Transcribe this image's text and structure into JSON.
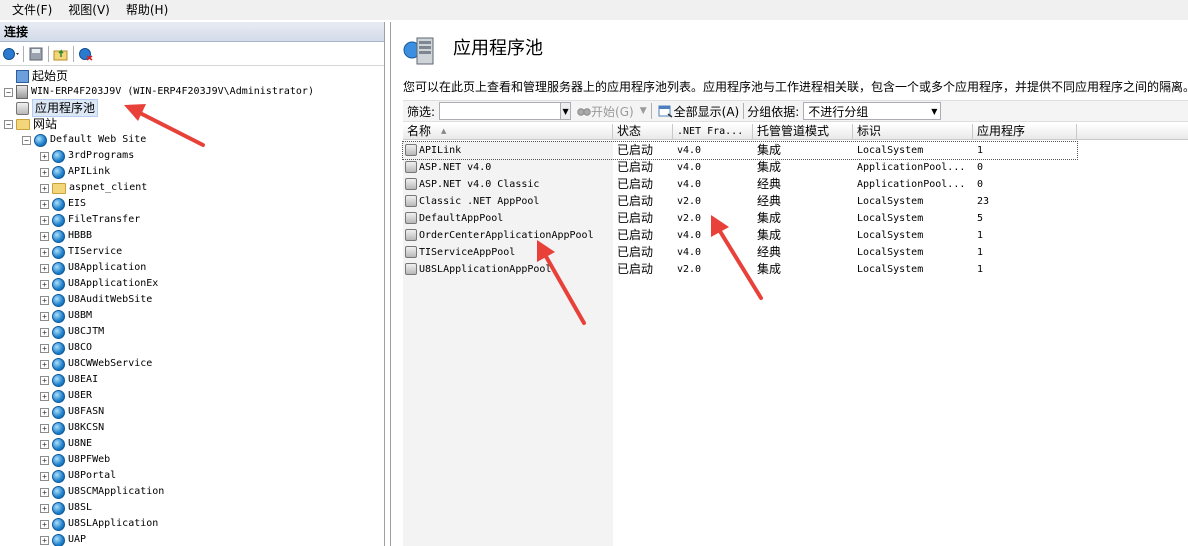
{
  "menu": [
    {
      "label": "文件(F)"
    },
    {
      "label": "视图(V)"
    },
    {
      "label": "帮助(H)"
    }
  ],
  "connections": {
    "title": "连接",
    "tree": [
      {
        "label": "起始页",
        "icon": "home-icon",
        "level": 0,
        "expander": "",
        "cn": true
      },
      {
        "label": "WIN-ERP4F203J9V (WIN-ERP4F203J9V\\Administrator)",
        "icon": "server-icon",
        "level": 0,
        "expander": "−",
        "cn": false
      },
      {
        "label": "应用程序池",
        "icon": "app-pool-icon",
        "level": 1,
        "expander": "",
        "cn": true,
        "selected": true
      },
      {
        "label": "网站",
        "icon": "sites-folder-icon",
        "level": 1,
        "expander": "−",
        "cn": true
      },
      {
        "label": "Default Web Site",
        "icon": "globe-icon",
        "level": 2,
        "expander": "−",
        "cn": false
      },
      {
        "label": "3rdPrograms",
        "icon": "globe-icon",
        "level": 3,
        "expander": "+",
        "cn": false
      },
      {
        "label": "APILink",
        "icon": "globe-icon",
        "level": 3,
        "expander": "+",
        "cn": false
      },
      {
        "label": "aspnet_client",
        "icon": "folder-icon",
        "level": 3,
        "expander": "+",
        "cn": false
      },
      {
        "label": "EIS",
        "icon": "globe-icon",
        "level": 3,
        "expander": "+",
        "cn": false
      },
      {
        "label": "FileTransfer",
        "icon": "globe-icon",
        "level": 3,
        "expander": "+",
        "cn": false
      },
      {
        "label": "HBBB",
        "icon": "globe-icon",
        "level": 3,
        "expander": "+",
        "cn": false
      },
      {
        "label": "TIService",
        "icon": "globe-icon",
        "level": 3,
        "expander": "+",
        "cn": false
      },
      {
        "label": "U8Application",
        "icon": "globe-icon",
        "level": 3,
        "expander": "+",
        "cn": false
      },
      {
        "label": "U8ApplicationEx",
        "icon": "globe-icon",
        "level": 3,
        "expander": "+",
        "cn": false
      },
      {
        "label": "U8AuditWebSite",
        "icon": "globe-icon",
        "level": 3,
        "expander": "+",
        "cn": false
      },
      {
        "label": "U8BM",
        "icon": "globe-icon",
        "level": 3,
        "expander": "+",
        "cn": false
      },
      {
        "label": "U8CJTM",
        "icon": "globe-icon",
        "level": 3,
        "expander": "+",
        "cn": false
      },
      {
        "label": "U8CO",
        "icon": "globe-icon",
        "level": 3,
        "expander": "+",
        "cn": false
      },
      {
        "label": "U8CWWebService",
        "icon": "globe-icon",
        "level": 3,
        "expander": "+",
        "cn": false
      },
      {
        "label": "U8EAI",
        "icon": "globe-icon",
        "level": 3,
        "expander": "+",
        "cn": false
      },
      {
        "label": "U8ER",
        "icon": "globe-icon",
        "level": 3,
        "expander": "+",
        "cn": false
      },
      {
        "label": "U8FASN",
        "icon": "globe-icon",
        "level": 3,
        "expander": "+",
        "cn": false
      },
      {
        "label": "U8KCSN",
        "icon": "globe-icon",
        "level": 3,
        "expander": "+",
        "cn": false
      },
      {
        "label": "U8NE",
        "icon": "globe-icon",
        "level": 3,
        "expander": "+",
        "cn": false
      },
      {
        "label": "U8PFWeb",
        "icon": "globe-icon",
        "level": 3,
        "expander": "+",
        "cn": false
      },
      {
        "label": "U8Portal",
        "icon": "globe-icon",
        "level": 3,
        "expander": "+",
        "cn": false
      },
      {
        "label": "U8SCMApplication",
        "icon": "globe-icon",
        "level": 3,
        "expander": "+",
        "cn": false
      },
      {
        "label": "U8SL",
        "icon": "globe-icon",
        "level": 3,
        "expander": "+",
        "cn": false
      },
      {
        "label": "U8SLApplication",
        "icon": "globe-icon",
        "level": 3,
        "expander": "+",
        "cn": false
      },
      {
        "label": "UAP",
        "icon": "globe-icon",
        "level": 3,
        "expander": "+",
        "cn": false
      }
    ]
  },
  "main": {
    "title": "应用程序池",
    "description": "您可以在此页上查看和管理服务器上的应用程序池列表。应用程序池与工作进程相关联，包含一个或多个应用程序，并提供不同应用程序之间的隔离。",
    "filter": {
      "label": "筛选:",
      "start_label": "开始(G)",
      "show_all_label": "全部显示(A)",
      "group_by_label": "分组依据:",
      "group_by_value": "不进行分组"
    },
    "columns": [
      "名称",
      "状态",
      ".NET Fra...",
      "托管管道模式",
      "标识",
      "应用程序"
    ],
    "pools": [
      {
        "name": "APILink",
        "status": "已启动",
        "net": "v4.0",
        "pipeline": "集成",
        "identity": "LocalSystem",
        "apps": "1"
      },
      {
        "name": "ASP.NET v4.0",
        "status": "已启动",
        "net": "v4.0",
        "pipeline": "集成",
        "identity": "ApplicationPool...",
        "apps": "0"
      },
      {
        "name": "ASP.NET v4.0 Classic",
        "status": "已启动",
        "net": "v4.0",
        "pipeline": "经典",
        "identity": "ApplicationPool...",
        "apps": "0"
      },
      {
        "name": "Classic .NET AppPool",
        "status": "已启动",
        "net": "v2.0",
        "pipeline": "经典",
        "identity": "LocalSystem",
        "apps": "23"
      },
      {
        "name": "DefaultAppPool",
        "status": "已启动",
        "net": "v2.0",
        "pipeline": "集成",
        "identity": "LocalSystem",
        "apps": "5"
      },
      {
        "name": "OrderCenterApplicationAppPool",
        "status": "已启动",
        "net": "v4.0",
        "pipeline": "集成",
        "identity": "LocalSystem",
        "apps": "1"
      },
      {
        "name": "TIServiceAppPool",
        "status": "已启动",
        "net": "v4.0",
        "pipeline": "经典",
        "identity": "LocalSystem",
        "apps": "1"
      },
      {
        "name": "U8SLApplicationAppPool",
        "status": "已启动",
        "net": "v2.0",
        "pipeline": "集成",
        "identity": "LocalSystem",
        "apps": "1"
      }
    ]
  },
  "colors": {
    "annotation_arrow": "#e8413a",
    "selection": "#dde8f7"
  }
}
